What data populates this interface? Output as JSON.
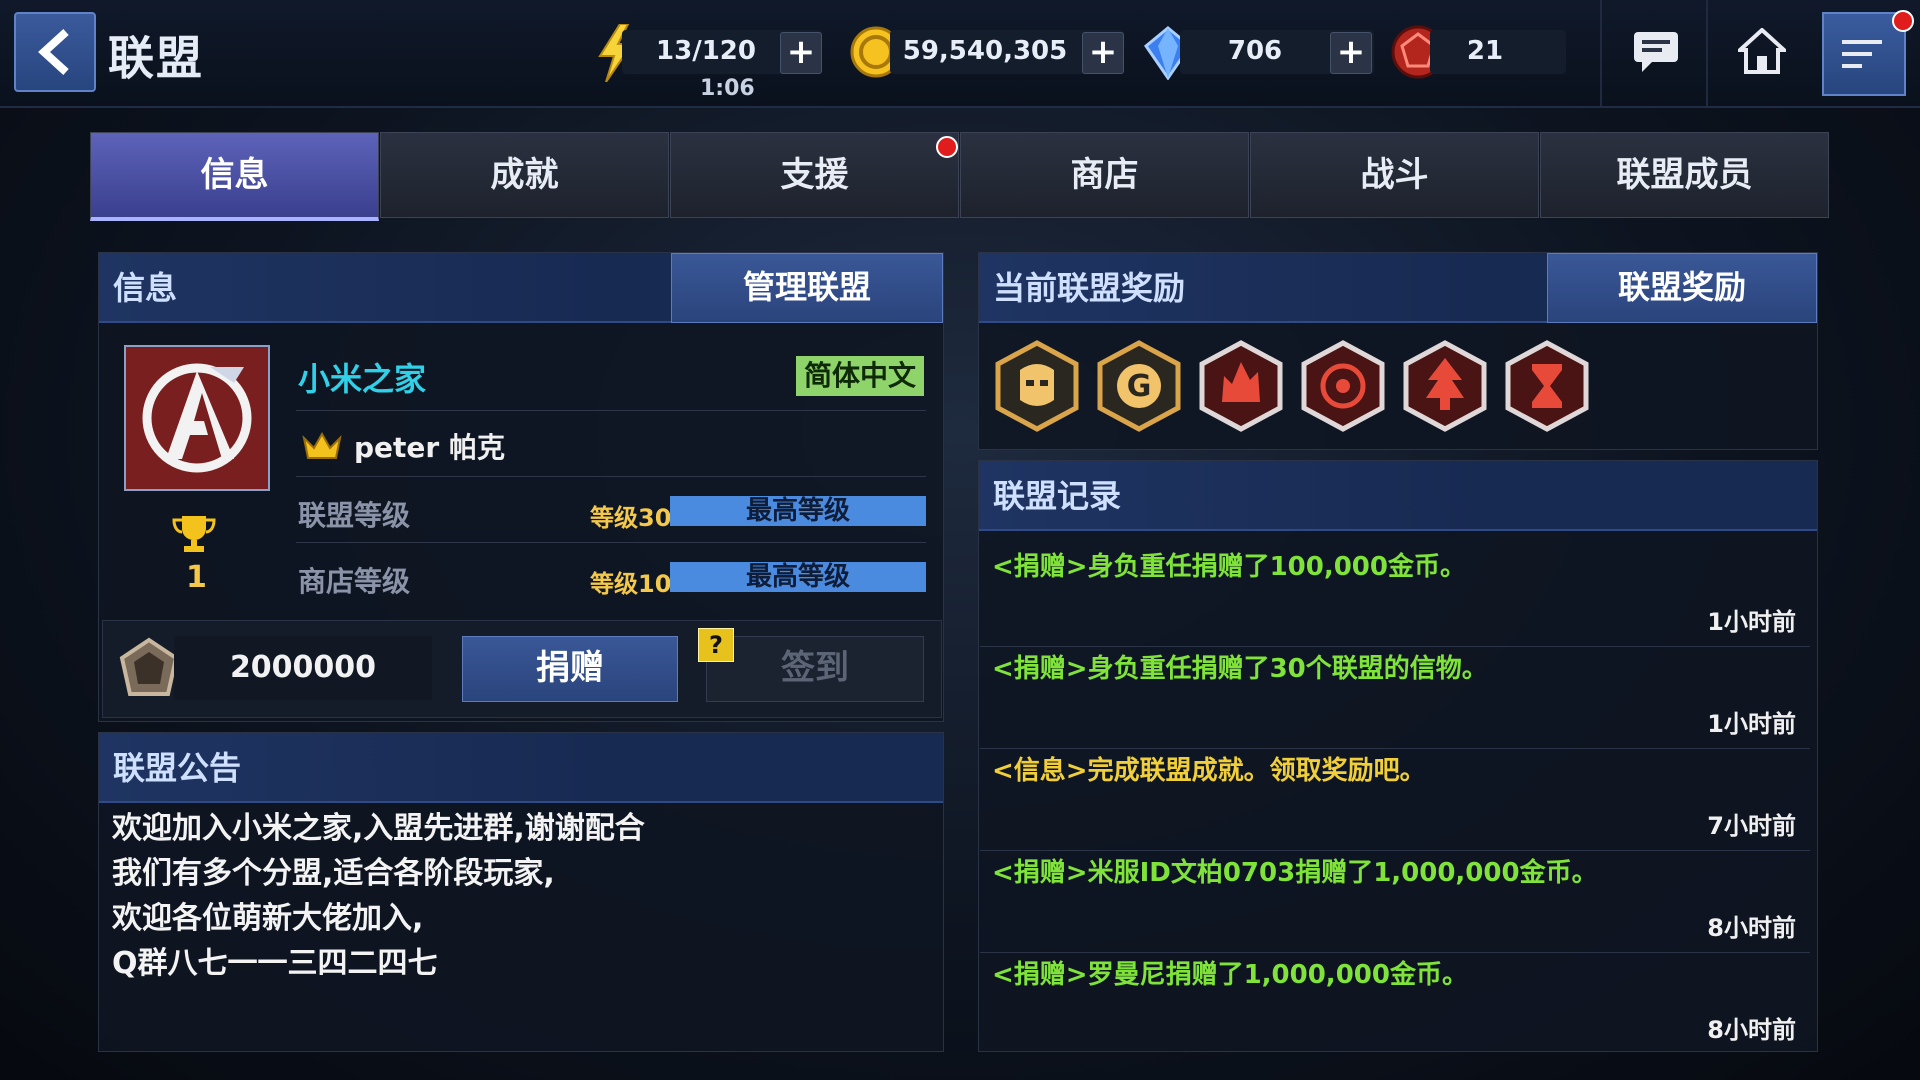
{
  "header": {
    "title": "联盟",
    "energy": "13/120",
    "energy_timer": "1:06",
    "gold": "59,540,305",
    "crystals": "706",
    "tokens": "21"
  },
  "tabs": [
    {
      "label": "信息",
      "active": true
    },
    {
      "label": "成就",
      "active": false
    },
    {
      "label": "支援",
      "active": false,
      "has_notification": true
    },
    {
      "label": "商店",
      "active": false
    },
    {
      "label": "战斗",
      "active": false
    },
    {
      "label": "联盟成员",
      "active": false
    }
  ],
  "info": {
    "header": "信息",
    "manage_button": "管理联盟",
    "alliance_name": "小米之家",
    "language": "简体中文",
    "leader": "peter 帕克",
    "alliance_level_label": "联盟等级",
    "alliance_level": "等级30",
    "alliance_level_status": "最高等级",
    "shop_level_label": "商店等级",
    "shop_level": "等级10",
    "shop_level_status": "最高等级",
    "rank": "1",
    "donation_amount": "2000000",
    "donate_button": "捐赠",
    "signin_button": "签到",
    "help": "?"
  },
  "notice": {
    "header": "联盟公告",
    "lines": [
      "欢迎加入小米之家,入盟先进群,谢谢配合",
      "我们有多个分盟,适合各阶段玩家,",
      "欢迎各位萌新大佬加入,",
      "Q群八七一一三四二四七"
    ]
  },
  "rewards": {
    "header": "当前联盟奖励",
    "button": "联盟奖励",
    "icons": [
      "helmet-icon",
      "gold-coin-icon",
      "flame-icon",
      "target-icon",
      "tree-icon",
      "hourglass-icon"
    ]
  },
  "records": {
    "header": "联盟记录",
    "entries": [
      {
        "text": "<捐赠>身负重任捐赠了100,000金币。",
        "time": "1小时前",
        "kind": "donate"
      },
      {
        "text": "<捐赠>身负重任捐赠了30个联盟的信物。",
        "time": "1小时前",
        "kind": "donate"
      },
      {
        "text": "<信息>完成联盟成就。领取奖励吧。",
        "time": "7小时前",
        "kind": "info"
      },
      {
        "text": "<捐赠>米服ID文柏0703捐赠了1,000,000金币。",
        "time": "8小时前",
        "kind": "donate"
      },
      {
        "text": "<捐赠>罗曼尼捐赠了1,000,000金币。",
        "time": "8小时前",
        "kind": "donate"
      }
    ]
  },
  "colors": {
    "accent": "#3a5797",
    "donate_log": "#7fe33a",
    "info_log": "#f0cf3a",
    "alliance_name": "#2fd0e8",
    "level_bar": "#4a8be0"
  }
}
